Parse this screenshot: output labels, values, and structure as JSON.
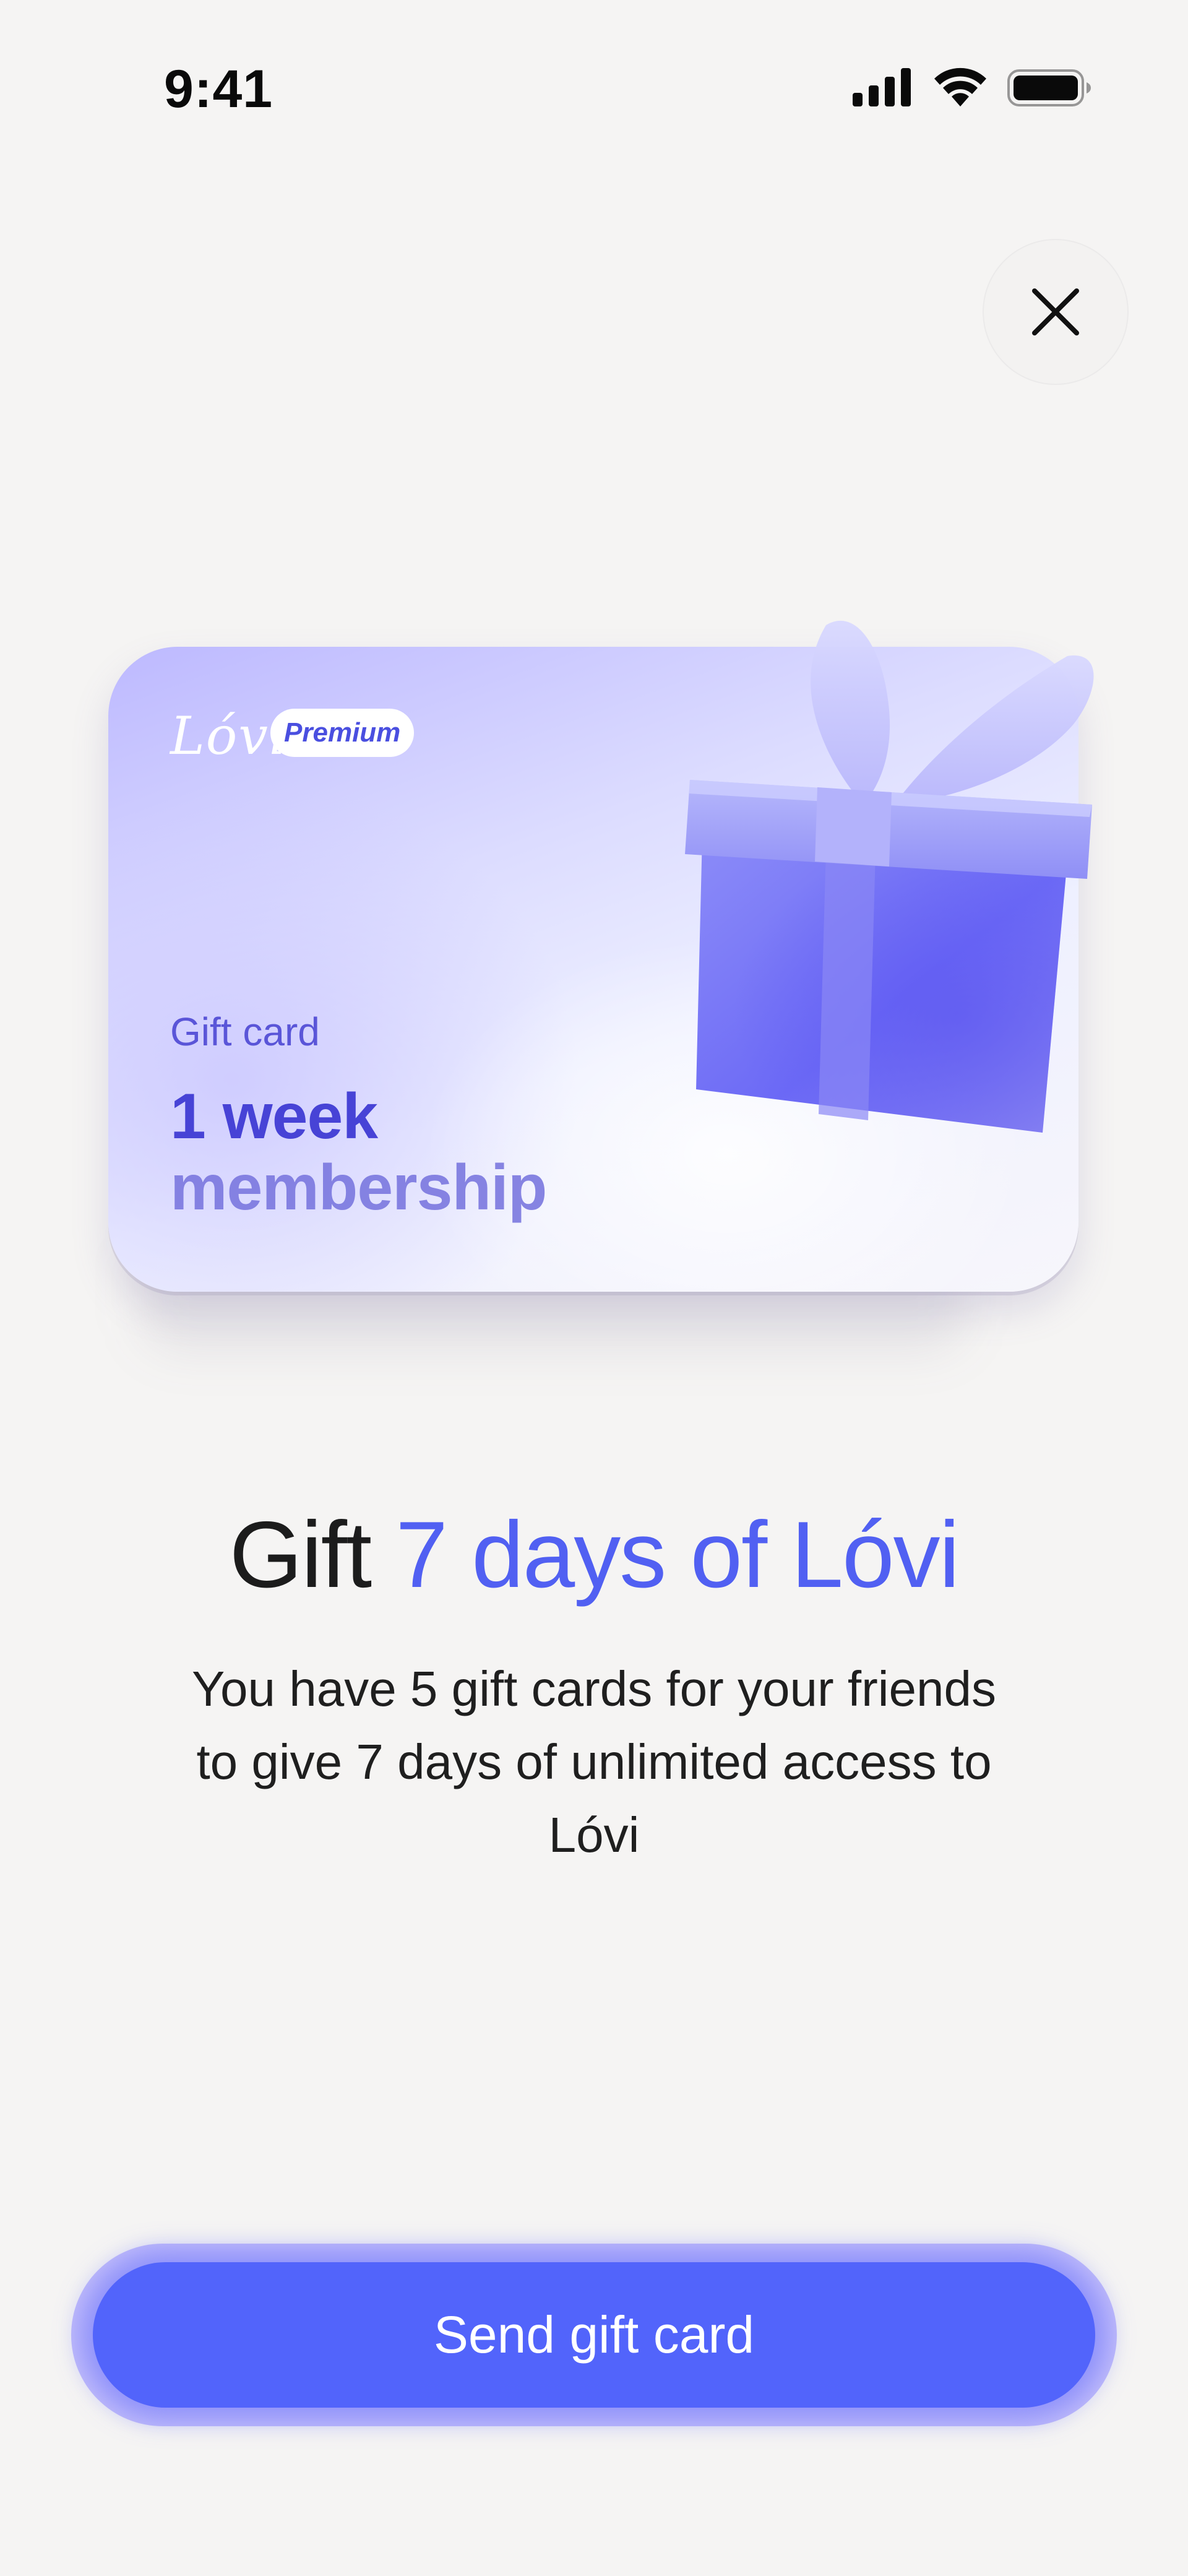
{
  "status_bar": {
    "time": "9:41",
    "icons": [
      "cellular-signal-icon",
      "wifi-icon",
      "battery-icon"
    ]
  },
  "close_button": {
    "icon": "close-icon"
  },
  "gift_card": {
    "logo_text": "Lóvi",
    "badge": "Premium",
    "subtitle": "Gift card",
    "title_line_1": "1 week",
    "title_line_2": "membership",
    "illustration": "gift-box-icon"
  },
  "headline": {
    "prefix": "Gift ",
    "highlight": "7 days of Lóvi"
  },
  "description": "You have 5 gift cards for your friends to give 7 days of unlimited access to Lóvi",
  "cta": {
    "label": "Send gift card"
  },
  "colors": {
    "accent": "#5264fb",
    "highlight_text": "#5160f2",
    "background": "#f5f4f3"
  }
}
